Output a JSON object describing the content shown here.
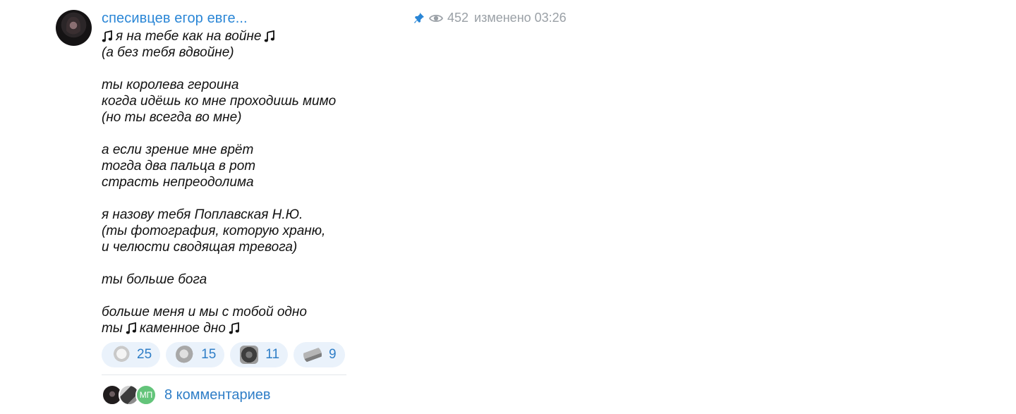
{
  "post": {
    "author": "спесивцев егор евге...",
    "views": "452",
    "edited": "изменено 03:26",
    "icons": {
      "pin": "pin-icon",
      "views": "eye-icon",
      "note": "music-note-icon"
    },
    "lines": [
      {
        "text": "я на тебе как на войне",
        "note_before": true,
        "note_after": true
      },
      {
        "text": "(а без тебя вдвойне)"
      },
      {
        "text": ""
      },
      {
        "text": "ты королева героина"
      },
      {
        "text": "когда идёшь ко мне проходишь мимо"
      },
      {
        "text": "(но ты всегда во мне)"
      },
      {
        "text": ""
      },
      {
        "text": "а если зрение мне врёт"
      },
      {
        "text": "тогда два пальца в рот"
      },
      {
        "text": "страсть непреодолима"
      },
      {
        "text": ""
      },
      {
        "text": "я назову тебя Поплавская Н.Ю."
      },
      {
        "text": "(ты фотография, которую храню,"
      },
      {
        "text": "и челюсти сводящая тревога)"
      },
      {
        "text": ""
      },
      {
        "text": "ты больше бога"
      },
      {
        "text": ""
      },
      {
        "text": "больше меня и мы с тобой одно"
      },
      {
        "text": "ты",
        "text2": "каменное дно",
        "note_mid": true,
        "note_after": true
      }
    ]
  },
  "reactions": [
    {
      "name": "reaction-hand-icon",
      "count": "25"
    },
    {
      "name": "reaction-moon-icon",
      "count": "15"
    },
    {
      "name": "reaction-photo-icon",
      "count": "11"
    },
    {
      "name": "reaction-plane-icon",
      "count": "9"
    }
  ],
  "comments": {
    "label": "8 комментариев",
    "avatars": [
      "avatar-user-1",
      "avatar-user-2",
      "МП"
    ]
  },
  "colors": {
    "link": "#2a86d6",
    "meta": "#9aa0a6",
    "chip_bg": "#eaf2fb"
  }
}
